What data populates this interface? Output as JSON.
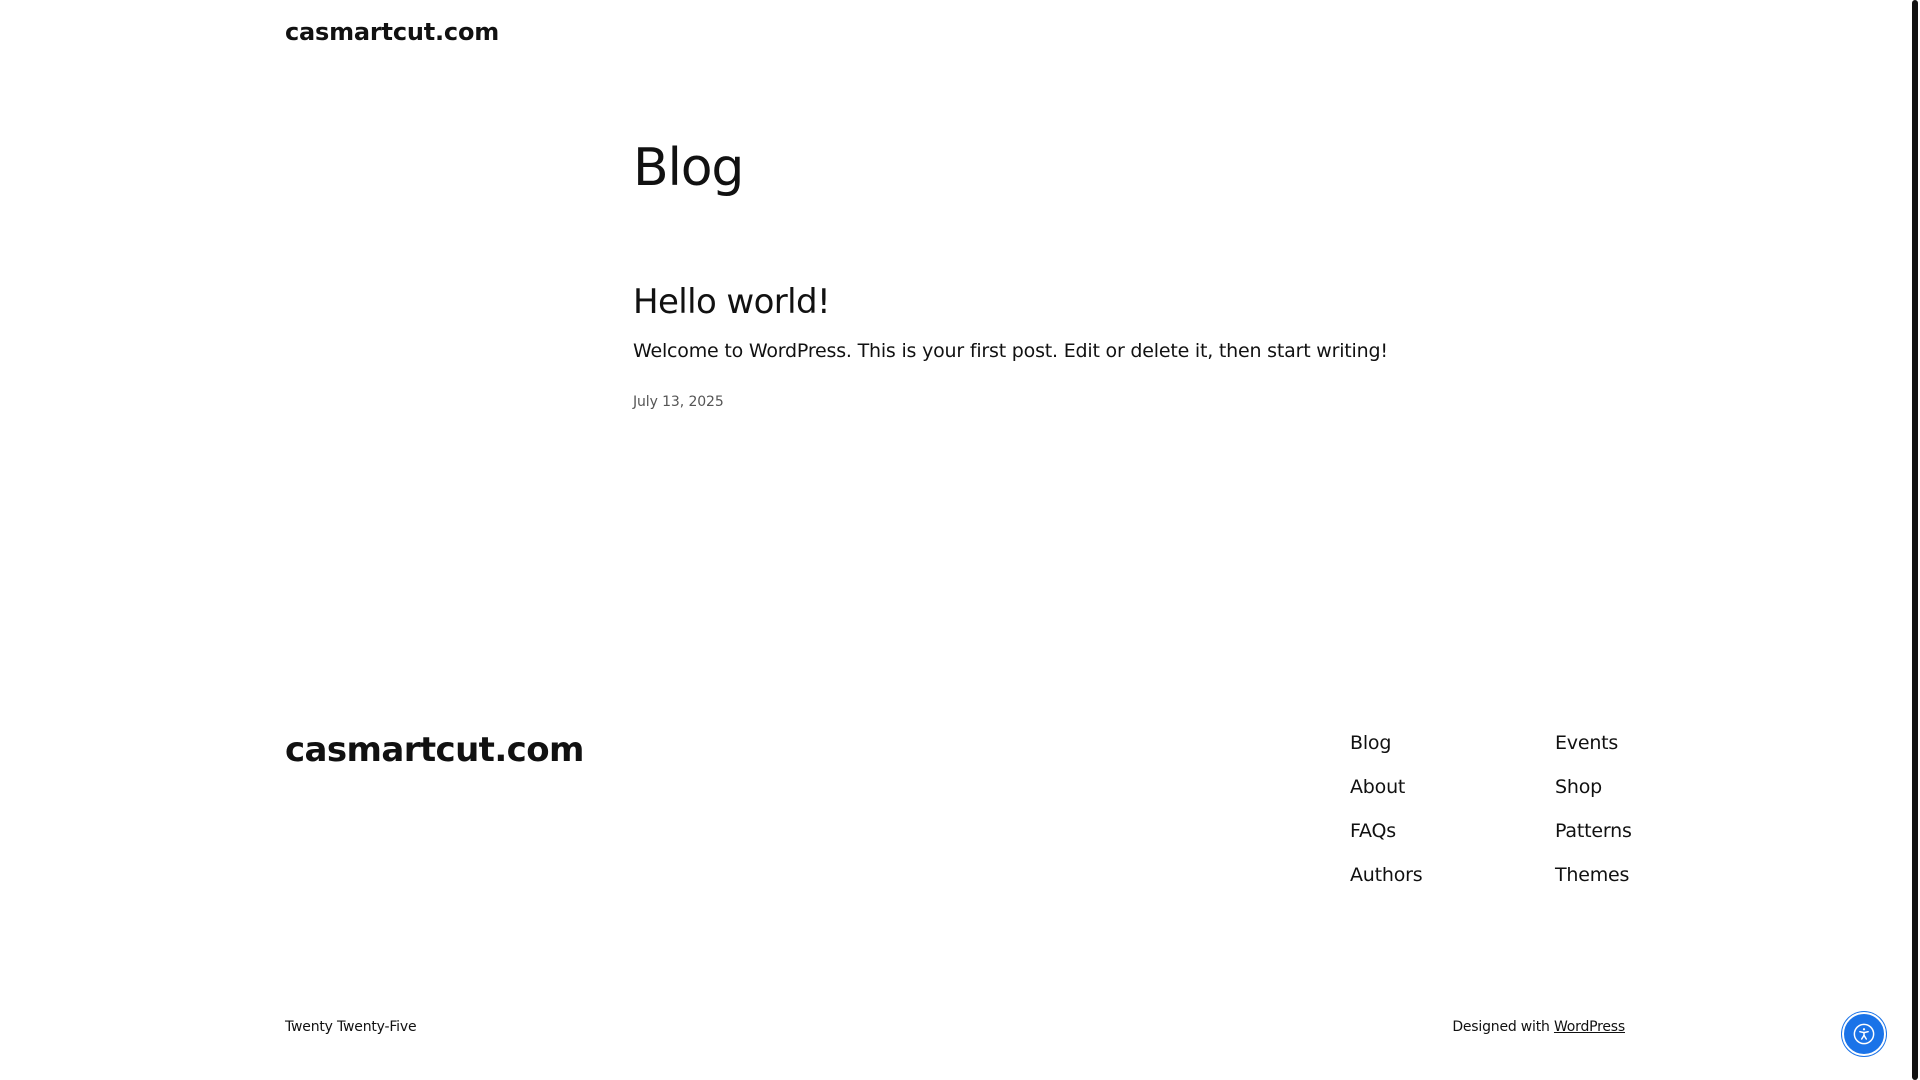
{
  "header": {
    "site_title": "casmartcut.com"
  },
  "main": {
    "page_title": "Blog",
    "posts": [
      {
        "title": "Hello world!",
        "excerpt": "Welcome to WordPress. This is your first post. Edit or delete it, then start writing!",
        "date": "July 13, 2025"
      }
    ]
  },
  "footer": {
    "site_title": "casmartcut.com",
    "nav_col_1": [
      "Blog",
      "About",
      "FAQs",
      "Authors"
    ],
    "nav_col_2": [
      "Events",
      "Shop",
      "Patterns",
      "Themes"
    ],
    "theme_credit": "Twenty Twenty-Five",
    "designed_with": "Designed with",
    "wordpress_link": "WordPress"
  },
  "accessibility_widget": {
    "icon": "accessibility-icon",
    "color": "#1a73e8"
  },
  "colors": {
    "text": "#111111",
    "background": "#ffffff",
    "date_text": "#555555"
  }
}
